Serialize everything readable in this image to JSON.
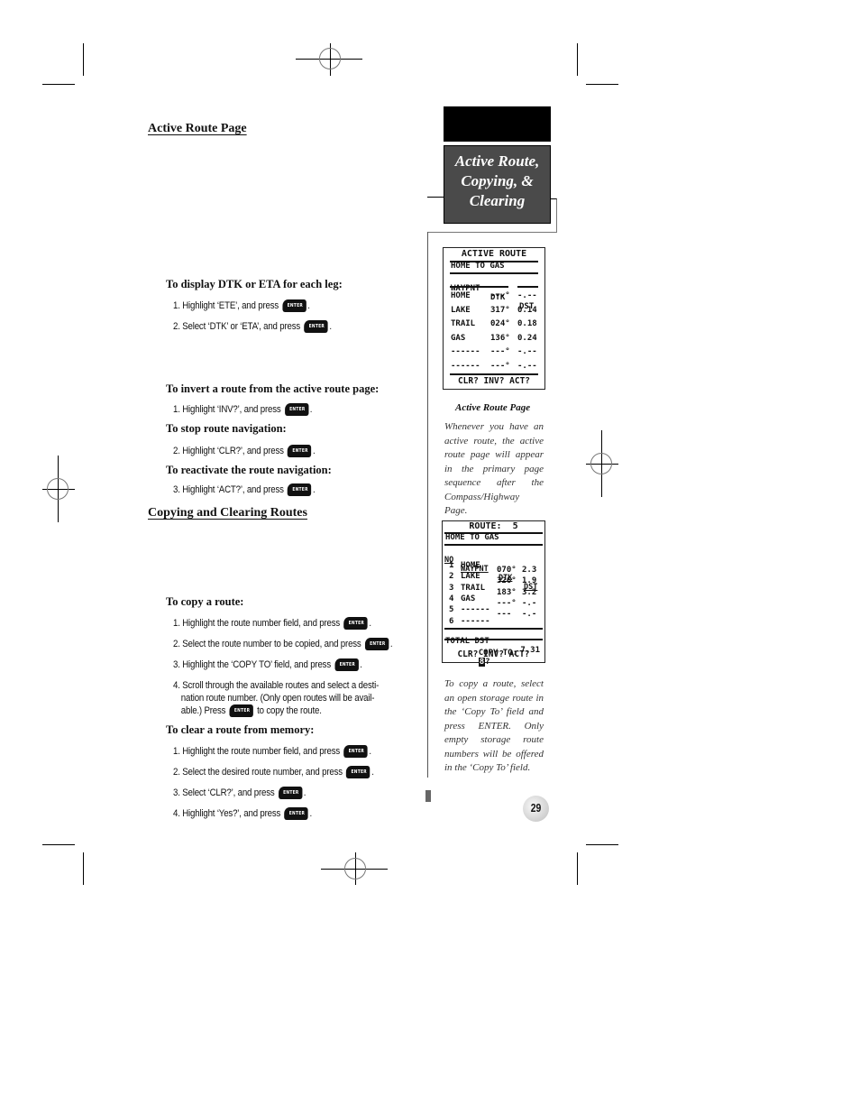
{
  "chapter_tab": {
    "title_line1": "Active Route,",
    "title_line2": "Copying, &",
    "title_line3": "Clearing"
  },
  "sections": {
    "active_route": {
      "heading": "Active Route Page",
      "dtk_eta": {
        "subhead": "To display DTK or ETA for each leg:",
        "steps": [
          "1. Highlight ‘ETE’, and press",
          "2. Select ‘DTK’ or ‘ETA’, and press"
        ]
      },
      "invert": {
        "subhead": "To invert a route from the active route page:",
        "step": "1. Highlight ‘INV?’, and press"
      },
      "stop": {
        "subhead": "To stop route navigation:",
        "step": "2. Highlight ‘CLR?’, and press"
      },
      "reactivate": {
        "subhead": "To reactivate the route navigation:",
        "step": "3. Highlight ‘ACT?’, and press"
      }
    },
    "copying": {
      "heading": "Copying and Clearing Routes",
      "copy": {
        "subhead": "To copy a route:",
        "steps": [
          "1. Highlight the route number field, and press",
          "2. Select the route number to be copied, and press",
          "3. Highlight the ‘COPY TO’ field, and press"
        ],
        "step4_a": "4. Scroll through the available routes and select a desti-",
        "step4_b": "nation route number. (Only open routes will be avail-",
        "step4_c": "able.) Press",
        "step4_d": "to copy the route."
      },
      "clear": {
        "subhead": "To clear a route from memory:",
        "steps": [
          "1. Highlight the route number field, and press",
          "2. Select the desired route number, and press",
          "3. Select ‘CLR?’, and press",
          "4. Highlight ‘Yes?’, and press"
        ]
      }
    }
  },
  "enter_key_label": "ENTER",
  "period": ".",
  "screen_active_route": {
    "title": "ACTIVE ROUTE",
    "route_name": "HOME TO GAS",
    "columns": [
      "WAYPNT",
      "DTK",
      "DST"
    ],
    "rows": [
      {
        "wpt": "HOME",
        "dtk": "---°",
        "dst": "-.--"
      },
      {
        "wpt": "LAKE",
        "dtk": "317°",
        "dst": "0.14"
      },
      {
        "wpt": "TRAIL",
        "dtk": "024°",
        "dst": "0.18"
      },
      {
        "wpt": "GAS",
        "dtk": "136°",
        "dst": "0.24"
      },
      {
        "wpt": "------",
        "dtk": "---°",
        "dst": "-.--"
      },
      {
        "wpt": "------",
        "dtk": "---°",
        "dst": "-.--"
      }
    ],
    "footer": "CLR? INV? ACT?"
  },
  "caption_active_route": {
    "title": "Active Route Page",
    "text": "Whenever you have an active route, the active route page will appear in the primary page sequence after the Compass/Highway Page."
  },
  "screen_route": {
    "title": "ROUTE:  5",
    "route_name": "HOME TO GAS",
    "columns": [
      "NO",
      "WAYPNT",
      "DTK",
      "DST"
    ],
    "rows": [
      {
        "no": "1",
        "wpt": "HOME"
      },
      {
        "no": "2",
        "wpt": "LAKE"
      },
      {
        "no": "3",
        "wpt": "TRAIL"
      },
      {
        "no": "4",
        "wpt": "GAS"
      },
      {
        "no": "5",
        "wpt": "------"
      },
      {
        "no": "6",
        "wpt": "------"
      }
    ],
    "legs": [
      {
        "dtk": "070°",
        "dst": "2.3"
      },
      {
        "dtk": "326°",
        "dst": "1.9"
      },
      {
        "dtk": "183°",
        "dst": "3.2"
      },
      {
        "dtk": "---°",
        "dst": "-.-"
      },
      {
        "dtk": "---",
        "dst": "-.-"
      }
    ],
    "total_label": "TOTAL DST",
    "total_value": "7.31",
    "copy_to_label": "COPY TO:",
    "copy_to_value": "8",
    "copy_to_suffix": "?",
    "footer": "CLR? INV? ACT?"
  },
  "caption_copy": {
    "text": "To copy a route, select an open storage route in the ‘Copy To’ field and press ENTER. Only empty storage route numbers will be offered in the ‘Copy To’ field."
  },
  "page_number": "29"
}
